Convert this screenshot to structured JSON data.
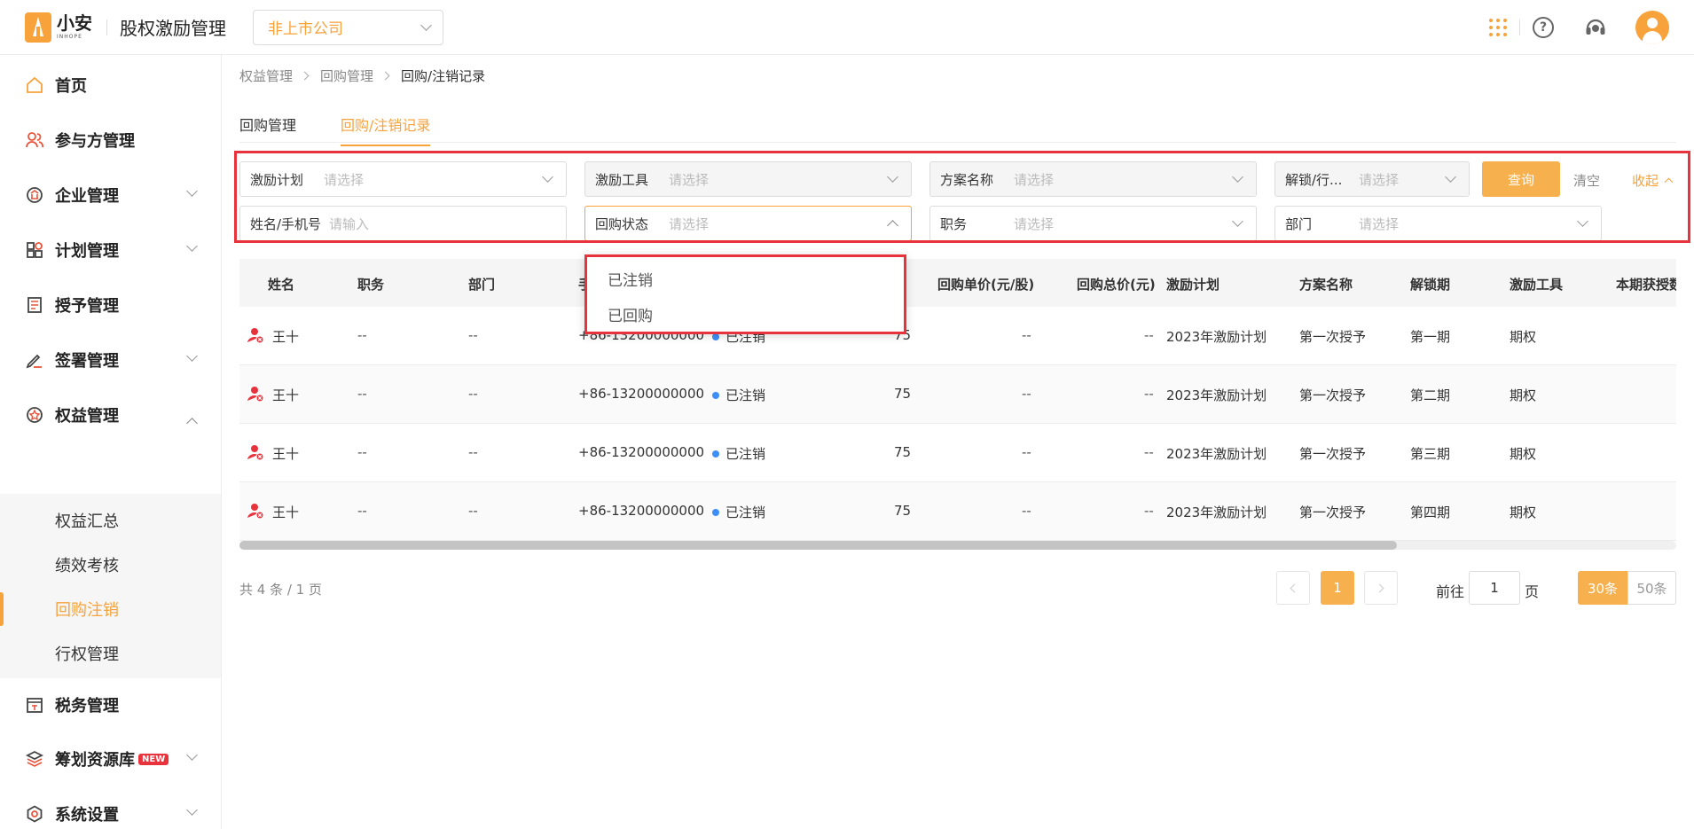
{
  "header": {
    "logo_text": "小安",
    "logo_sub": "INHOPE",
    "app_title": "股权激励管理",
    "company_select": "非上市公司",
    "help_icon_glyph": "?"
  },
  "sidebar": {
    "items": [
      {
        "label": "首页",
        "icon": "home-icon"
      },
      {
        "label": "参与方管理",
        "icon": "people-icon"
      },
      {
        "label": "企业管理",
        "icon": "enterprise-icon"
      },
      {
        "label": "计划管理",
        "icon": "plan-icon"
      },
      {
        "label": "授予管理",
        "icon": "grant-icon"
      },
      {
        "label": "签署管理",
        "icon": "sign-icon"
      },
      {
        "label": "权益管理",
        "icon": "equity-icon"
      },
      {
        "label": "税务管理",
        "icon": "tax-icon"
      },
      {
        "label": "筹划资源库",
        "icon": "layers-icon",
        "badge": "NEW"
      },
      {
        "label": "系统设置",
        "icon": "settings-icon"
      }
    ],
    "sub_items": [
      "权益汇总",
      "绩效考核",
      "回购注销",
      "行权管理"
    ]
  },
  "breadcrumb": [
    "权益管理",
    "回购管理",
    "回购/注销记录"
  ],
  "tabs": [
    "回购管理",
    "回购/注销记录"
  ],
  "filters": {
    "plan": {
      "label": "激励计划",
      "placeholder": "请选择"
    },
    "tool": {
      "label": "激励工具",
      "placeholder": "请选择"
    },
    "scheme": {
      "label": "方案名称",
      "placeholder": "请选择"
    },
    "unlock": {
      "label": "解锁/行...",
      "placeholder": "请选择"
    },
    "name": {
      "label": "姓名/手机号",
      "placeholder": "请输入"
    },
    "status": {
      "label": "回购状态",
      "placeholder": "请选择"
    },
    "position": {
      "label": "职务",
      "placeholder": "请选择"
    },
    "dept": {
      "label": "部门",
      "placeholder": "请选择"
    },
    "query_label": "查询",
    "clear_label": "清空",
    "collapse_label": "收起"
  },
  "dropdown_options": [
    "已注销",
    "已回购"
  ],
  "table": {
    "columns": [
      "姓名",
      "职务",
      "部门",
      "手",
      "回购单价(元/股)",
      "回购总价(元)",
      "激励计划",
      "方案名称",
      "解锁期",
      "激励工具",
      "本期获授数"
    ],
    "rows": [
      {
        "name": "王十",
        "position": "--",
        "dept": "--",
        "phone": "+86-13200000000",
        "status": "已注销",
        "qty": "75",
        "unit_price": "--",
        "total_price": "--",
        "plan": "2023年激励计划",
        "scheme": "第一次授予",
        "period": "第一期",
        "tool": "期权"
      },
      {
        "name": "王十",
        "position": "--",
        "dept": "--",
        "phone": "+86-13200000000",
        "status": "已注销",
        "qty": "75",
        "unit_price": "--",
        "total_price": "--",
        "plan": "2023年激励计划",
        "scheme": "第一次授予",
        "period": "第二期",
        "tool": "期权"
      },
      {
        "name": "王十",
        "position": "--",
        "dept": "--",
        "phone": "+86-13200000000",
        "status": "已注销",
        "qty": "75",
        "unit_price": "--",
        "total_price": "--",
        "plan": "2023年激励计划",
        "scheme": "第一次授予",
        "period": "第三期",
        "tool": "期权"
      },
      {
        "name": "王十",
        "position": "--",
        "dept": "--",
        "phone": "+86-13200000000",
        "status": "已注销",
        "qty": "75",
        "unit_price": "--",
        "total_price": "--",
        "plan": "2023年激励计划",
        "scheme": "第一次授予",
        "period": "第四期",
        "tool": "期权"
      }
    ]
  },
  "pagination": {
    "total_text": "共 4 条 / 1 页",
    "current_page": "1",
    "goto_label": "前往",
    "goto_value": "1",
    "goto_unit": "页",
    "size_options": [
      "30条",
      "50条"
    ]
  },
  "colors": {
    "accent": "#f7a23b",
    "highlight": "#e8323c",
    "status_dot": "#3e8ef7"
  }
}
